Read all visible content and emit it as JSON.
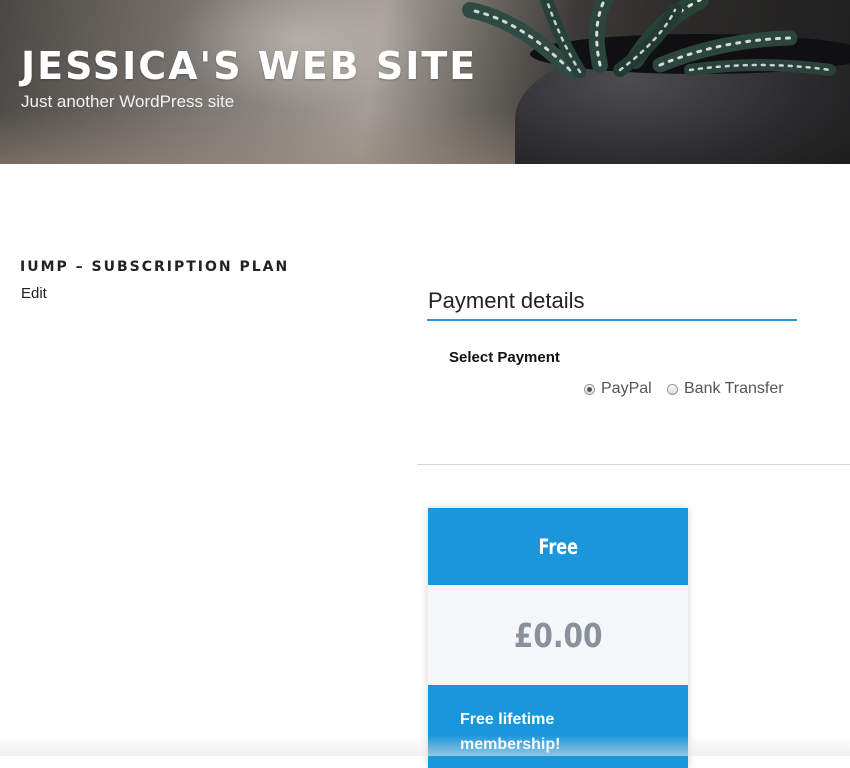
{
  "header": {
    "site_title": "JESSICA'S WEB SITE",
    "tagline": "Just another WordPress site"
  },
  "page": {
    "title": "IUMP – SUBSCRIPTION PLAN",
    "edit_label": "Edit"
  },
  "payment": {
    "heading": "Payment details",
    "select_label": "Select Payment",
    "options": [
      {
        "label": "PayPal",
        "checked": true
      },
      {
        "label": "Bank Transfer",
        "checked": false
      }
    ],
    "accent_color": "#2e9bd6"
  },
  "plan": {
    "name": "Free",
    "price": "£0.00",
    "description": "Free lifetime membership!",
    "color": "#1a96db"
  }
}
